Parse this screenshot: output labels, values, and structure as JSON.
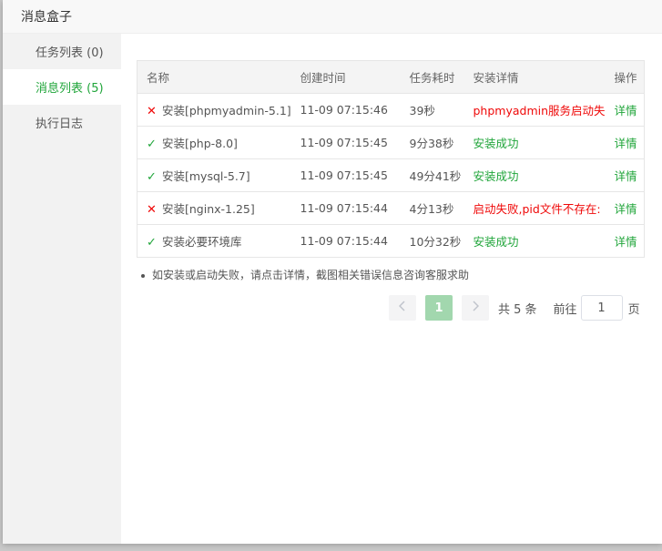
{
  "dialog": {
    "title": "消息盒子"
  },
  "sidebar": {
    "items": [
      {
        "label": "任务列表 (0)"
      },
      {
        "label": "消息列表 (5)"
      },
      {
        "label": "执行日志"
      }
    ]
  },
  "table": {
    "headers": [
      "名称",
      "创建时间",
      "任务耗时",
      "安装详情",
      "操作"
    ],
    "rows": [
      {
        "status": "fail",
        "name": "安装[phpmyadmin-5.1]",
        "time": "11-09 07:15:46",
        "duration": "39秒",
        "detail": "phpmyadmin服务启动失",
        "action": "详情"
      },
      {
        "status": "ok",
        "name": "安装[php-8.0]",
        "time": "11-09 07:15:45",
        "duration": "9分38秒",
        "detail": "安装成功",
        "action": "详情"
      },
      {
        "status": "ok",
        "name": "安装[mysql-5.7]",
        "time": "11-09 07:15:45",
        "duration": "49分41秒",
        "detail": "安装成功",
        "action": "详情"
      },
      {
        "status": "fail",
        "name": "安装[nginx-1.25]",
        "time": "11-09 07:15:44",
        "duration": "4分13秒",
        "detail": "启动失败,pid文件不存在:",
        "action": "详情"
      },
      {
        "status": "ok",
        "name": "安装必要环境库",
        "time": "11-09 07:15:44",
        "duration": "10分32秒",
        "detail": "安装成功",
        "action": "详情"
      }
    ]
  },
  "tip": "如安装或启动失败，请点击详情，截图相关错误信息咨询客服求助",
  "pagination": {
    "current": "1",
    "total": "共 5 条",
    "goto_label": "前往",
    "goto_value": "1",
    "page_suffix": "页"
  },
  "colors": {
    "success": "#20a53a",
    "error": "#ef0808",
    "active_page": "#a2d7ae"
  },
  "icons": {
    "fail": "close-x-icon",
    "ok": "check-icon",
    "prev": "chevron-left-icon",
    "next": "chevron-right-icon"
  }
}
